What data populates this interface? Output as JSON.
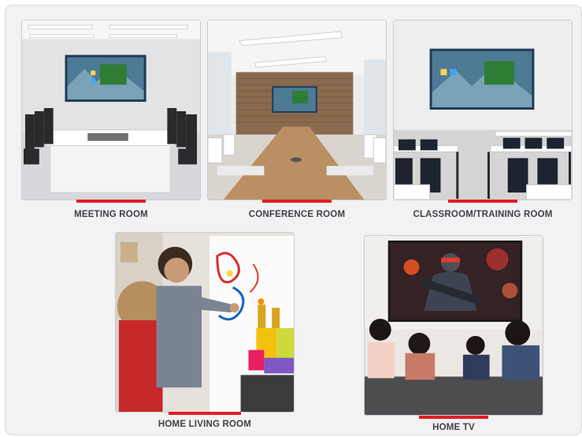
{
  "colors": {
    "accent_bar": "#e01e26",
    "caption_text": "#3f4047",
    "panel_bg": "#f2f2f3"
  },
  "cards": [
    {
      "caption": "MEETING ROOM",
      "image": "meeting-room-photo"
    },
    {
      "caption": "CONFERENCE ROOM",
      "image": "conference-room-photo"
    },
    {
      "caption": "CLASSROOM/TRAINING ROOM",
      "image": "classroom-photo"
    },
    {
      "caption": "HOME LIVING ROOM",
      "image": "kids-at-interactive-board-photo"
    },
    {
      "caption": "HOME TV",
      "image": "family-watching-tv-photo"
    }
  ]
}
